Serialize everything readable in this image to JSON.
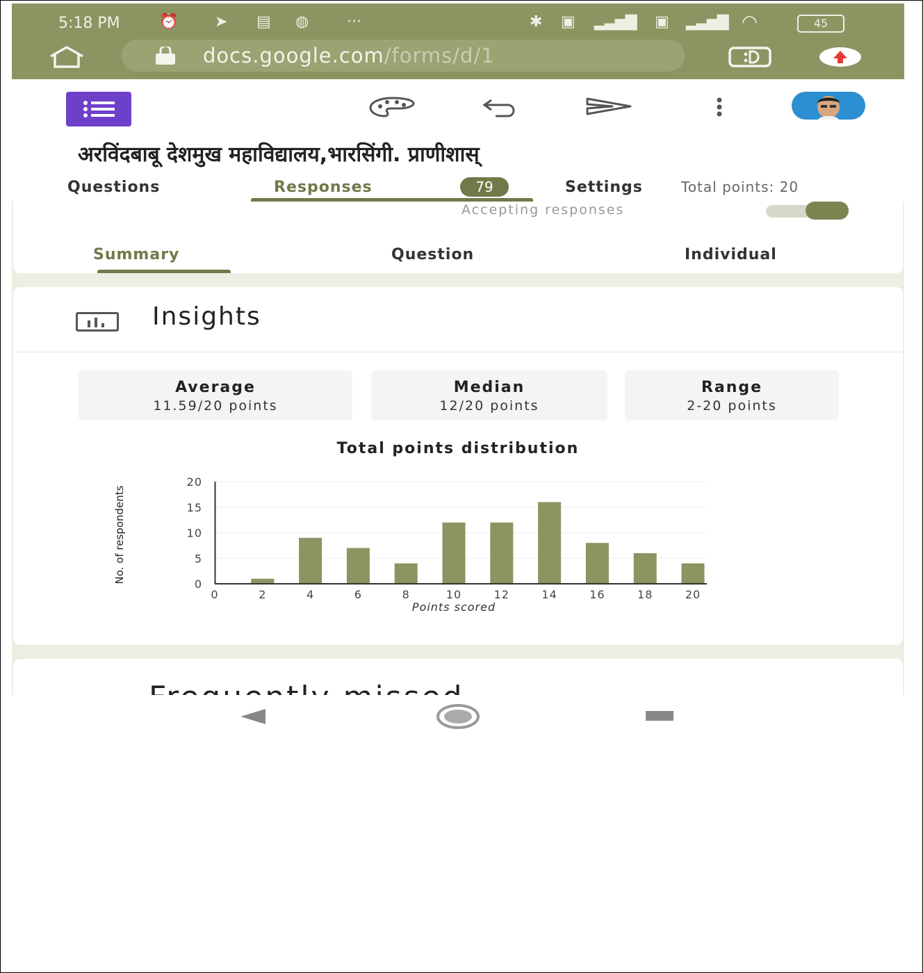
{
  "status_bar": {
    "time": "5:18 PM",
    "more": "···",
    "battery": "45"
  },
  "browser": {
    "url_host": "docs.google.com",
    "url_path": "/forms/d/1"
  },
  "form": {
    "title": "अरविंदबाबू देशमुख महाविद्यालय,भारसिंगी. प्राणीशास्"
  },
  "tabs": {
    "questions": "Questions",
    "responses": "Responses",
    "responses_count": "79",
    "settings": "Settings",
    "total_points": "Total points: 20"
  },
  "responses": {
    "accepting_label": "Accepting responses",
    "accepting_on": true,
    "subtabs": {
      "summary": "Summary",
      "question": "Question",
      "individual": "Individual"
    }
  },
  "insights": {
    "title": "Insights",
    "average_label": "Average",
    "average_value": "11.59/20 points",
    "median_label": "Median",
    "median_value": "12/20 points",
    "range_label": "Range",
    "range_value": "2-20 points"
  },
  "next_section": {
    "title": "Frequently missed"
  },
  "colors": {
    "accent": "#6f7a48",
    "bar": "#8b9562",
    "chrome": "#8b9562"
  },
  "chart_data": {
    "type": "bar",
    "title": "Total points distribution",
    "xlabel": "Points scored",
    "ylabel": "No. of respondents",
    "x": [
      2,
      4,
      6,
      8,
      10,
      12,
      14,
      16,
      18,
      20
    ],
    "values": [
      1,
      9,
      7,
      4,
      12,
      12,
      16,
      8,
      6,
      4
    ],
    "xlim": [
      0,
      20
    ],
    "ylim": [
      0,
      20
    ],
    "x_ticks": [
      "0",
      "2",
      "4",
      "6",
      "8",
      "10",
      "12",
      "14",
      "16",
      "18",
      "20"
    ],
    "y_ticks": [
      "0",
      "5",
      "10",
      "15",
      "20"
    ],
    "grid": true,
    "legend": false
  }
}
